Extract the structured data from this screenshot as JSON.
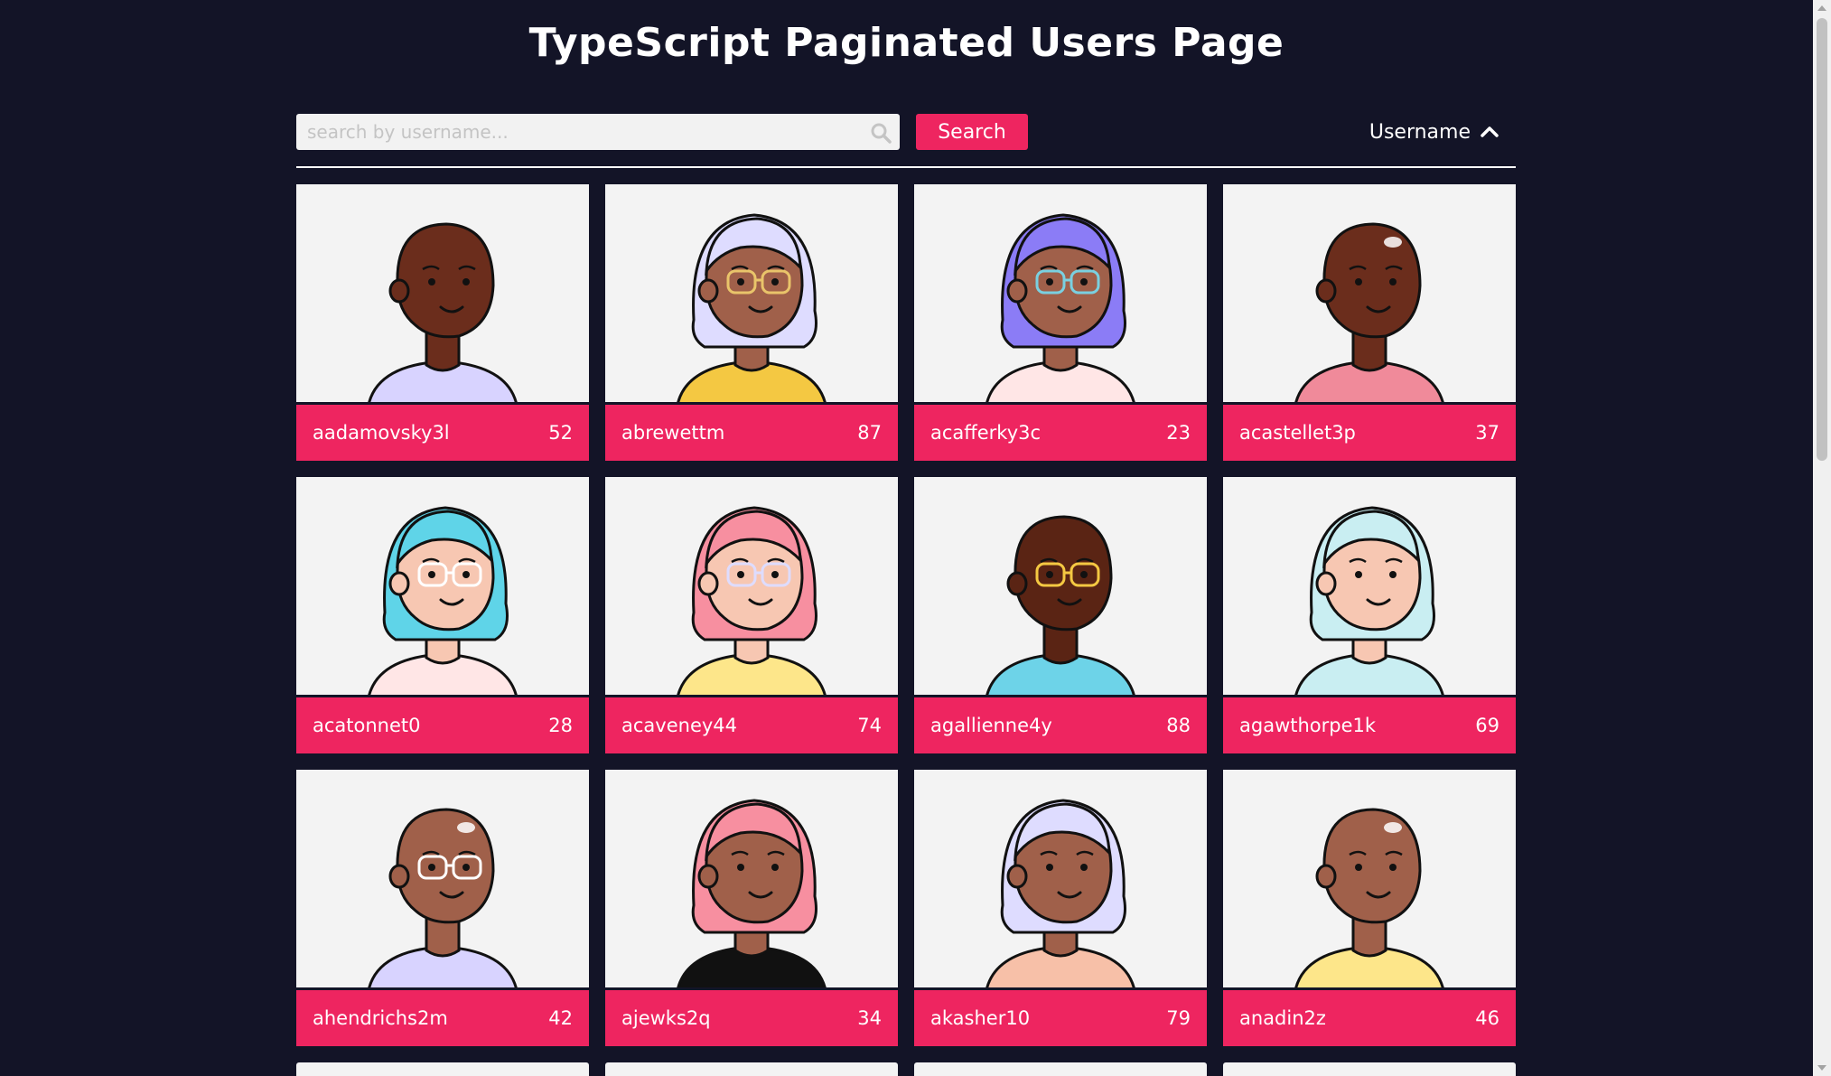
{
  "page": {
    "title": "TypeScript Paginated Users Page"
  },
  "search": {
    "placeholder": "search by username...",
    "value": "",
    "button_label": "Search"
  },
  "sort": {
    "label": "Username",
    "direction": "ascending",
    "icon": "chevron-up-icon"
  },
  "colors": {
    "background": "#131427",
    "accent": "#ee2560",
    "card_bg": "#f3f3f3"
  },
  "users": [
    {
      "username": "aadamovsky3l",
      "count": "52",
      "avatar": {
        "skin": "#6b2d1c",
        "hair": "none",
        "shirt": "#d8d3ff",
        "glasses": ""
      }
    },
    {
      "username": "abrewettm",
      "count": "87",
      "avatar": {
        "skin": "#a0604a",
        "hair": "#dedcff",
        "shirt": "#f4c842",
        "glasses": "#e9c46a"
      }
    },
    {
      "username": "acafferky3c",
      "count": "23",
      "avatar": {
        "skin": "#a0604a",
        "hair": "#8b7cf6",
        "shirt": "#ffe6e6",
        "glasses": "#7ad0e0"
      }
    },
    {
      "username": "acastellet3p",
      "count": "37",
      "avatar": {
        "skin": "#6b2d1c",
        "hair": "bald",
        "shirt": "#f08a9a",
        "glasses": ""
      }
    },
    {
      "username": "acatonnet0",
      "count": "28",
      "avatar": {
        "skin": "#f7c7b2",
        "hair": "#5fd4e8",
        "shirt": "#ffe6e6",
        "glasses": "#ffffff"
      }
    },
    {
      "username": "acaveney44",
      "count": "74",
      "avatar": {
        "skin": "#f7c7b2",
        "hair": "#f78fa0",
        "shirt": "#fde68a",
        "glasses": "#dedcff"
      }
    },
    {
      "username": "agallienne4y",
      "count": "88",
      "avatar": {
        "skin": "#5a2414",
        "hair": "none",
        "shirt": "#6dd3e8",
        "glasses": "#f4c842"
      }
    },
    {
      "username": "agawthorpe1k",
      "count": "69",
      "avatar": {
        "skin": "#f7c7b2",
        "hair": "#c9eef2",
        "shirt": "#c9eef2",
        "glasses": ""
      }
    },
    {
      "username": "ahendrichs2m",
      "count": "42",
      "avatar": {
        "skin": "#a0604a",
        "hair": "bald",
        "shirt": "#d8d3ff",
        "glasses": "#ffffff"
      }
    },
    {
      "username": "ajewks2q",
      "count": "34",
      "avatar": {
        "skin": "#a0604a",
        "hair": "#f78fa0",
        "shirt": "#111111",
        "glasses": ""
      }
    },
    {
      "username": "akasher10",
      "count": "79",
      "avatar": {
        "skin": "#a0604a",
        "hair": "#dedcff",
        "shirt": "#f7c0a8",
        "glasses": ""
      }
    },
    {
      "username": "anadin2z",
      "count": "46",
      "avatar": {
        "skin": "#a0604a",
        "hair": "bald",
        "shirt": "#fde68a",
        "glasses": ""
      }
    }
  ]
}
